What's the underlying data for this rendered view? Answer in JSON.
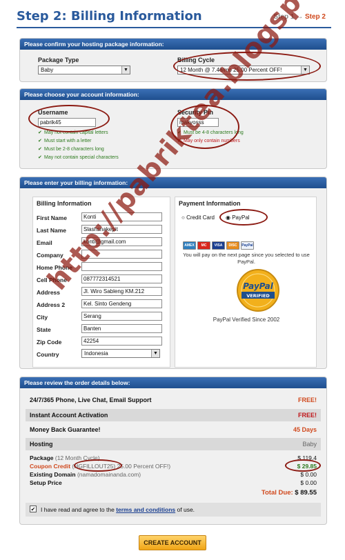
{
  "header": {
    "title": "Step 2: Billing Information",
    "steps": {
      "step1": "Step 1",
      "arrow": "→",
      "step2": "Step 2"
    }
  },
  "package_panel": {
    "heading": "Please confirm your hosting package information:",
    "package_type_label": "Package Type",
    "package_type_value": "Baby",
    "billing_cycle_label": "Billing Cycle",
    "billing_cycle_value": "12 Month @ 7.46/mo 25.00 Percent OFF!"
  },
  "account_panel": {
    "heading": "Please choose your account information:",
    "username_label": "Username",
    "username_value": "pabrik45",
    "username_rules": [
      "May not contain capital letters",
      "Must start with a letter",
      "Must be 2-8 characters long",
      "May not contain special characters"
    ],
    "pin_label": "Security Pin",
    "pin_value": "makyosss",
    "pin_rules": [
      {
        "mark": "✔",
        "text": "Must be 4-8 characters long",
        "ok": true
      },
      {
        "mark": "✘",
        "text": "May only contain numbers",
        "ok": false
      }
    ]
  },
  "billing_panel": {
    "heading": "Please enter your billing information:",
    "billing_title": "Billing Information",
    "fields": [
      {
        "label": "First Name",
        "value": "Konti"
      },
      {
        "label": "Last Name",
        "value": "Slashsnakepit"
      },
      {
        "label": "Email",
        "value": "konti@gmail.com"
      },
      {
        "label": "Company",
        "value": ""
      },
      {
        "label": "Home Phone",
        "value": ""
      },
      {
        "label": "Cell Phone",
        "value": "087772314521"
      },
      {
        "label": "Address",
        "value": "Jl. Wiro Sableng KM.212"
      },
      {
        "label": "Address 2",
        "value": "Kel. Sinto Gendeng"
      },
      {
        "label": "City",
        "value": "Serang"
      },
      {
        "label": "State",
        "value": "Banten"
      },
      {
        "label": "Zip Code",
        "value": "42254"
      }
    ],
    "country_label": "Country",
    "country_value": "Indonesia",
    "payment_title": "Payment Information",
    "credit_card_label": "Credit Card",
    "paypal_label": "PayPal",
    "paypal_note": "You will pay on the next page since you selected to use PayPal.",
    "seal_line1": "PayPal",
    "seal_line2": "VERIFIED",
    "verified_since": "PayPal Verified Since 2002",
    "cards": [
      "AMEX",
      "MC",
      "VISA",
      "DISC",
      "PayPal"
    ]
  },
  "order_panel": {
    "heading": "Please review the order details below:",
    "support_label": "24/7/365 Phone, Live Chat, Email Support",
    "support_value": "FREE!",
    "activation_label": "Instant Account Activation",
    "activation_value": "FREE!",
    "guarantee_label": "Money Back Guarantee!",
    "guarantee_value": "45 Days",
    "hosting_label": "Hosting",
    "hosting_value": "Baby",
    "package_label": "Package",
    "package_cycle": "(12 Month Cycle)",
    "package_value": "$ 119.4",
    "coupon_label": "Coupon Credit",
    "coupon_code": "(HGFILLOUT25)",
    "coupon_desc": "25.00 Percent OFF!)",
    "coupon_value": "$ 29.85",
    "domain_label": "Existing Domain",
    "domain_value_text": "(namadomainanda.com)",
    "domain_value": "$ 0.00",
    "setup_label": "Setup Price",
    "setup_value": "$ 0.00",
    "total_label": "Total Due:",
    "total_value": "$ 89.55",
    "terms_prefix": "I have read and agree to the",
    "terms_link": "terms and conditions",
    "terms_suffix": "of use."
  },
  "create_button": "CREATE ACCOUNT",
  "watermark": "http://pabriktea.blogspot.com"
}
